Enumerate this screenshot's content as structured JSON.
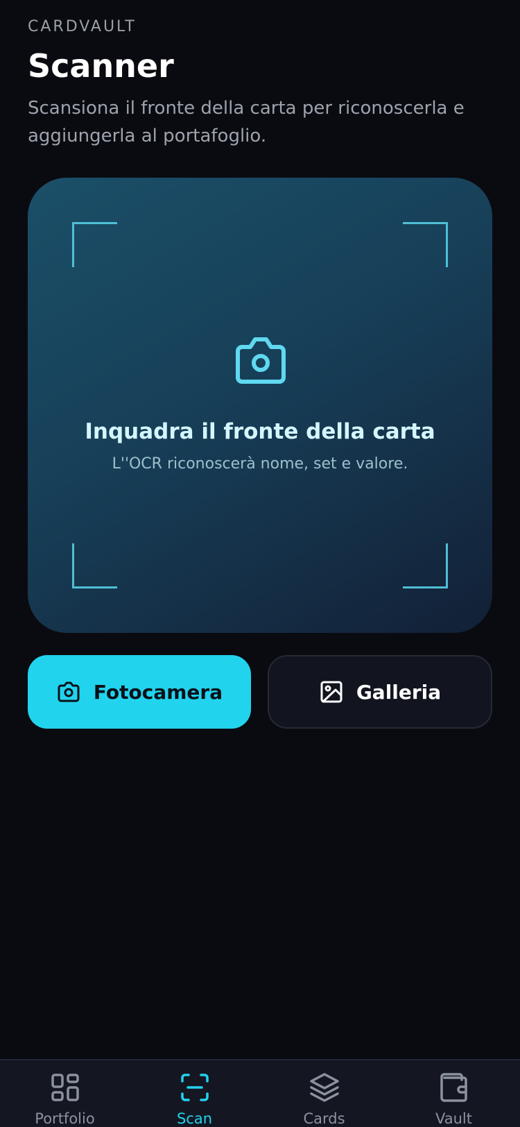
{
  "header": {
    "app_label": "CARDVAULT",
    "title": "Scanner",
    "subtitle": "Scansiona il fronte della carta per riconoscerla e aggiungerla al portafoglio."
  },
  "scan_frame": {
    "icon": "camera-icon",
    "title": "Inquadra il fronte della carta",
    "hint": "L''OCR riconoscerà nome, set e valore."
  },
  "actions": {
    "camera_label": "Fotocamera",
    "camera_icon": "camera-icon",
    "gallery_label": "Galleria",
    "gallery_icon": "image-icon"
  },
  "bottom_nav": {
    "active": "Scan",
    "items": [
      {
        "label": "Portfolio",
        "icon": "grid-icon"
      },
      {
        "label": "Scan",
        "icon": "scan-icon"
      },
      {
        "label": "Cards",
        "icon": "layers-icon"
      },
      {
        "label": "Vault",
        "icon": "wallet-icon"
      }
    ]
  },
  "colors": {
    "accent": "#22d3ee",
    "background": "#0a0b10",
    "frame_gradient_start": "#1b4f68",
    "frame_gradient_end": "#122036",
    "corner_marks": "#4fbfd6"
  }
}
